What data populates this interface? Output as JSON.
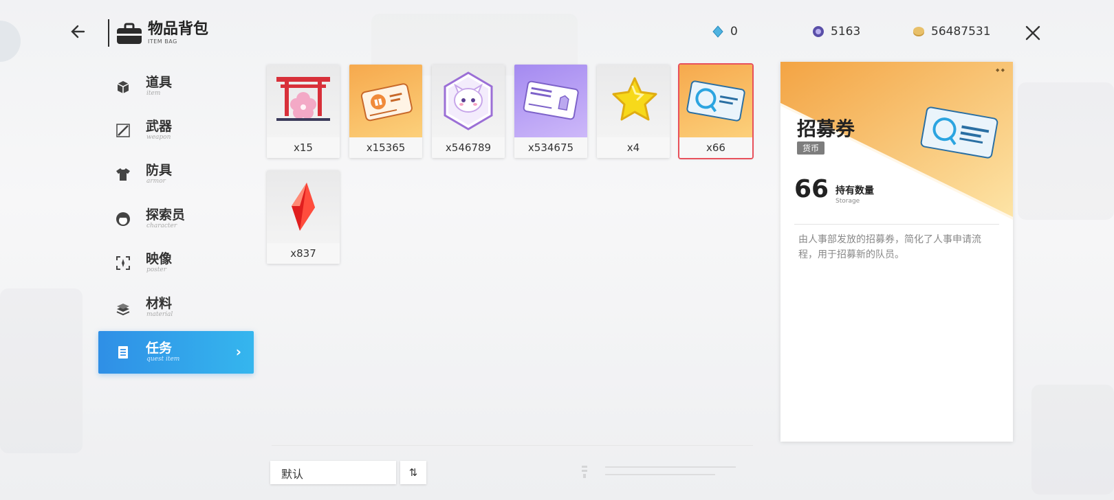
{
  "header": {
    "title": "物品背包",
    "subtitle": "ITEM BAG"
  },
  "currencies": [
    {
      "icon": "diamond-icon",
      "value": "0",
      "color": "#4fb3e0"
    },
    {
      "icon": "purple-gem-icon",
      "value": "5163",
      "color": "#5a4fa8"
    },
    {
      "icon": "gold-coin-icon",
      "value": "56487531",
      "color": "#c99a3f"
    }
  ],
  "sidebar": {
    "items": [
      {
        "label": "道具",
        "en": "item",
        "icon": "box-icon",
        "active": false
      },
      {
        "label": "武器",
        "en": "weapon",
        "icon": "sword-icon",
        "active": false
      },
      {
        "label": "防具",
        "en": "armor",
        "icon": "shirt-icon",
        "active": false
      },
      {
        "label": "探索员",
        "en": "character",
        "icon": "head-icon",
        "active": false
      },
      {
        "label": "映像",
        "en": "poster",
        "icon": "focus-icon",
        "active": false
      },
      {
        "label": "材料",
        "en": "material",
        "icon": "stack-icon",
        "active": false
      },
      {
        "label": "任务",
        "en": "quest item",
        "icon": "clipboard-icon",
        "active": true
      }
    ]
  },
  "items": [
    {
      "count": "x15",
      "icon": "sakura-gate-icon",
      "bg": "gray",
      "selected": false
    },
    {
      "count": "x15365",
      "icon": "gift-card-icon",
      "bg": "orange",
      "selected": false
    },
    {
      "count": "x546789",
      "icon": "neko-badge-icon",
      "bg": "gray",
      "selected": false
    },
    {
      "count": "x534675",
      "icon": "fashion-voucher-icon",
      "bg": "purple",
      "selected": false
    },
    {
      "count": "x4",
      "icon": "star-icon",
      "bg": "gray",
      "selected": false
    },
    {
      "count": "x66",
      "icon": "recruitment-voucher-icon",
      "bg": "orange",
      "selected": true
    },
    {
      "count": "x837",
      "icon": "red-crystal-icon",
      "bg": "gray",
      "selected": false
    }
  ],
  "detail": {
    "name": "招募券",
    "tag": "货币",
    "quantity": "66",
    "quantity_label": "持有数量",
    "quantity_en": "Storage",
    "description": "由人事部发放的招募券，简化了人事申请流程，用于招募新的队员。"
  },
  "footer": {
    "sort_label": "默认",
    "sort_toggle": "⇅"
  }
}
